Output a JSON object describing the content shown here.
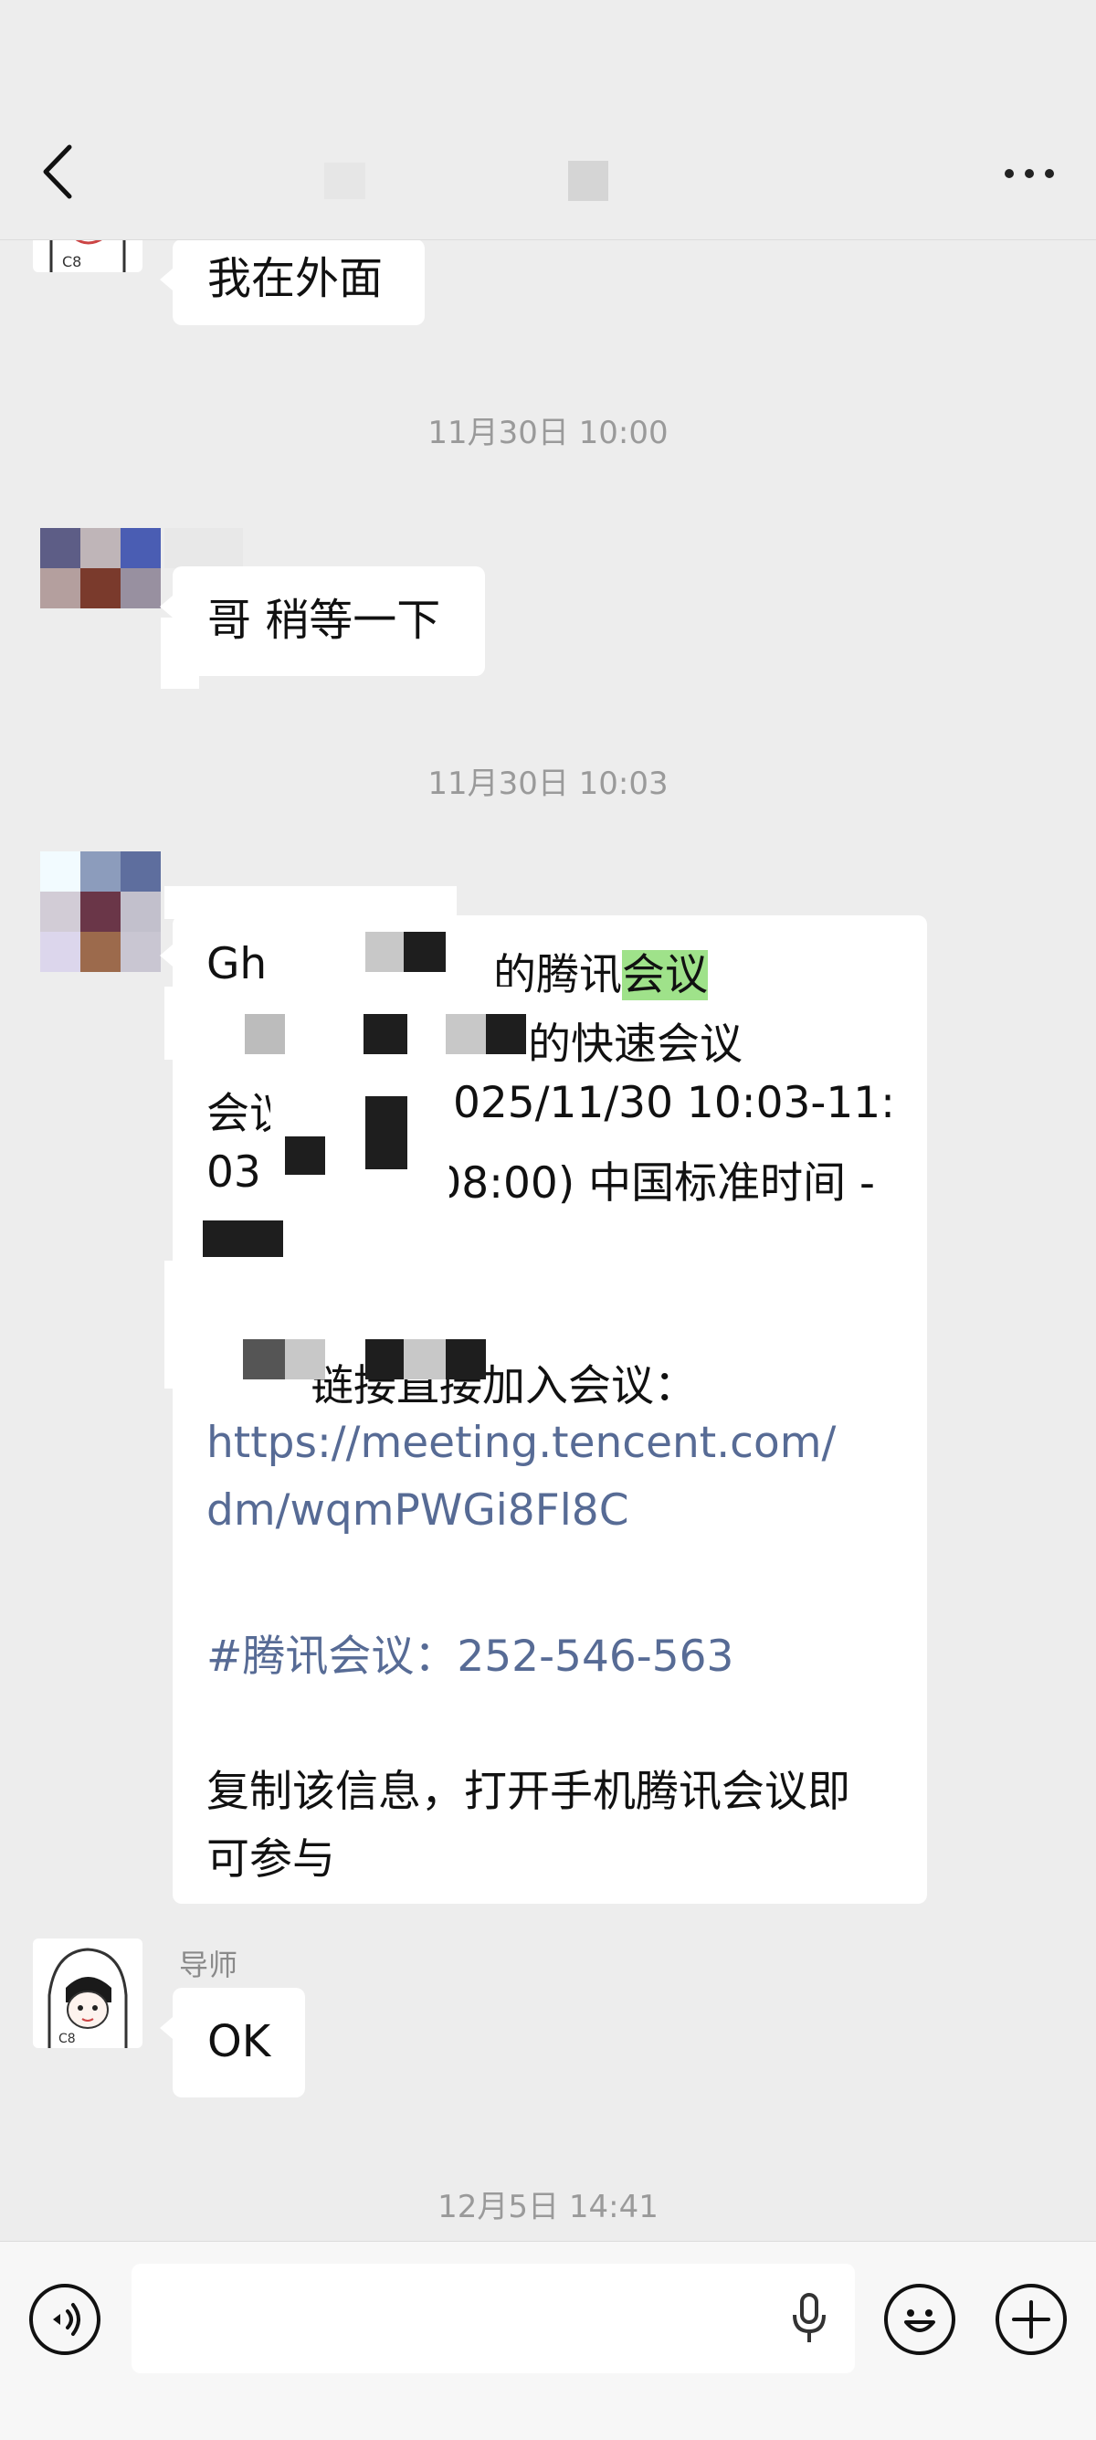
{
  "header": {
    "back_icon": "chevron-left-icon",
    "more_icon": "ellipsis-icon"
  },
  "messages": {
    "m1_text": "我在外面",
    "time1": "11月30日 10:00",
    "m2_text": "哥 稍等一下",
    "time2": "11月30日 10:03",
    "meeting": {
      "line1_prefix": "Gh",
      "line1_mid": "的腾讯",
      "line1_highlight": "会议",
      "line2": "的快速会议",
      "line3_prefix": "会议时",
      "line3_suffix": "025/11/30 10:03-11:",
      "line4_prefix": "03",
      "line4_suffix": "+08:00) 中国标准时间 -",
      "line6": "链接直接加入会议：",
      "link_line1": "https://meeting.tencent.com/",
      "link_line2": "dm/wqmPWGi8Fl8C",
      "meeting_id": "#腾讯会议：252-546-563",
      "footer1": "复制该信息，打开手机腾讯会议即",
      "footer2": "可参与"
    },
    "m4_sender": "导师",
    "m4_text": "OK",
    "time3": "12月5日 14:41"
  },
  "input_bar": {
    "voice_icon": "voice-toggle-icon",
    "mic_icon": "microphone-icon",
    "emoji_icon": "emoji-icon",
    "plus_icon": "plus-icon",
    "input_value": ""
  }
}
